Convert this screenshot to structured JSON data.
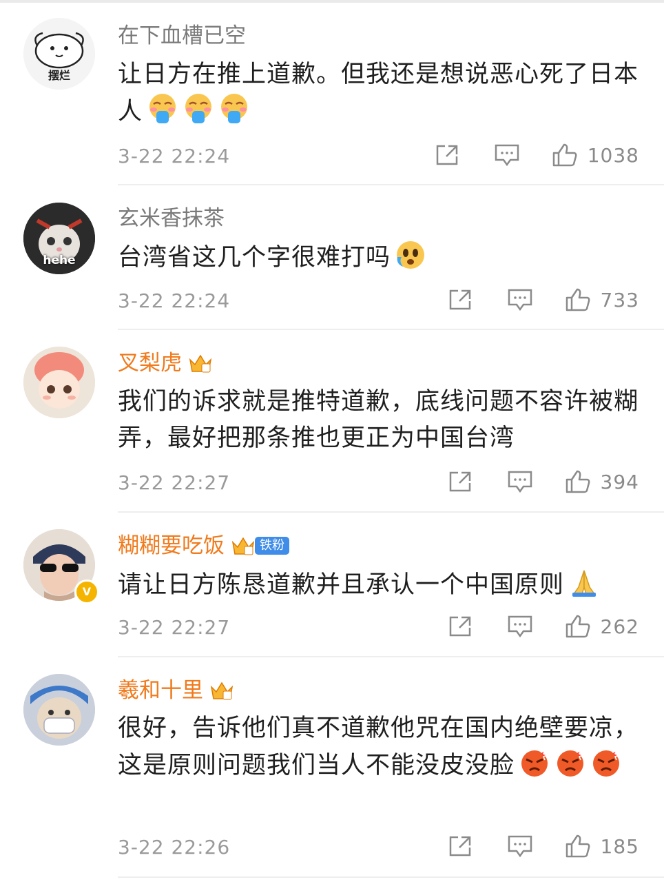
{
  "comments": [
    {
      "username": "在下血槽已空",
      "member": false,
      "avatar_caption": "摆烂",
      "text": "让日方在推上道歉。但我还是想说恶心死了日本人",
      "emojis": [
        "vomit-emoji",
        "vomit-emoji",
        "vomit-emoji"
      ],
      "time": "3-22 22:24",
      "likes": "1038"
    },
    {
      "username": "玄米香抹茶",
      "member": false,
      "avatar_caption": "hehe",
      "text": "台湾省这几个字很难打吗",
      "emojis": [
        "crying-face-emoji"
      ],
      "time": "3-22 22:24",
      "likes": "733"
    },
    {
      "username": "叉梨虎",
      "member": true,
      "text": "我们的诉求就是推特道歉，底线问题不容许被糊弄，最好把那条推也更正为中国台湾",
      "emojis": [],
      "time": "3-22 22:27",
      "likes": "394"
    },
    {
      "username": "糊糊要吃饭",
      "member": true,
      "fan_badge": "铁粉",
      "verified": "V",
      "text": "请让日方陈恳道歉并且承认一个中国原则",
      "emojis": [
        "pray-hands-emoji"
      ],
      "time": "3-22 22:27",
      "likes": "262"
    },
    {
      "username": "羲和十里",
      "member": true,
      "text": "很好，告诉他们真不道歉他咒在国内绝壁要凉，这是原则问题我们当人不能没皮没脸",
      "emojis": [
        "angry-face-emoji",
        "angry-face-emoji",
        "angry-face-emoji"
      ],
      "time": "3-22 22:26",
      "likes": "185"
    }
  ],
  "icons": {
    "share": "share-icon",
    "reply": "comment-icon",
    "like": "thumbs-up-icon"
  },
  "colors": {
    "member_name": "#f07a1c",
    "fan_badge": "#3f8de8",
    "verified_badge": "#f5b400"
  }
}
